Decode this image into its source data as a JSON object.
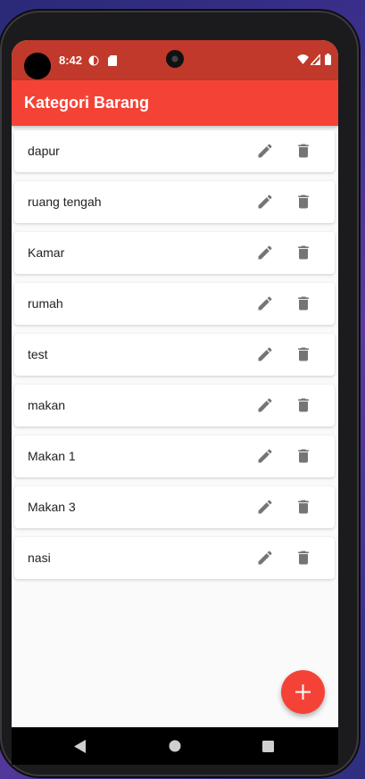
{
  "status_bar": {
    "time": "8:42",
    "icons": [
      "dnd-icon",
      "sim-card-icon",
      "wifi-icon",
      "signal-icon",
      "battery-icon"
    ]
  },
  "app_bar": {
    "title": "Kategori Barang",
    "color": "#f44336"
  },
  "categories": [
    {
      "name": "dapur"
    },
    {
      "name": "ruang tengah"
    },
    {
      "name": "Kamar"
    },
    {
      "name": "rumah"
    },
    {
      "name": "test"
    },
    {
      "name": "makan"
    },
    {
      "name": "Makan 1"
    },
    {
      "name": "Makan 3"
    },
    {
      "name": "nasi"
    }
  ],
  "row_actions": {
    "edit_icon": "pencil-icon",
    "delete_icon": "trash-icon"
  },
  "fab": {
    "icon": "plus-icon",
    "color": "#f44336"
  },
  "navigation_bar": {
    "buttons": [
      "back-icon",
      "home-icon",
      "recents-icon"
    ]
  }
}
